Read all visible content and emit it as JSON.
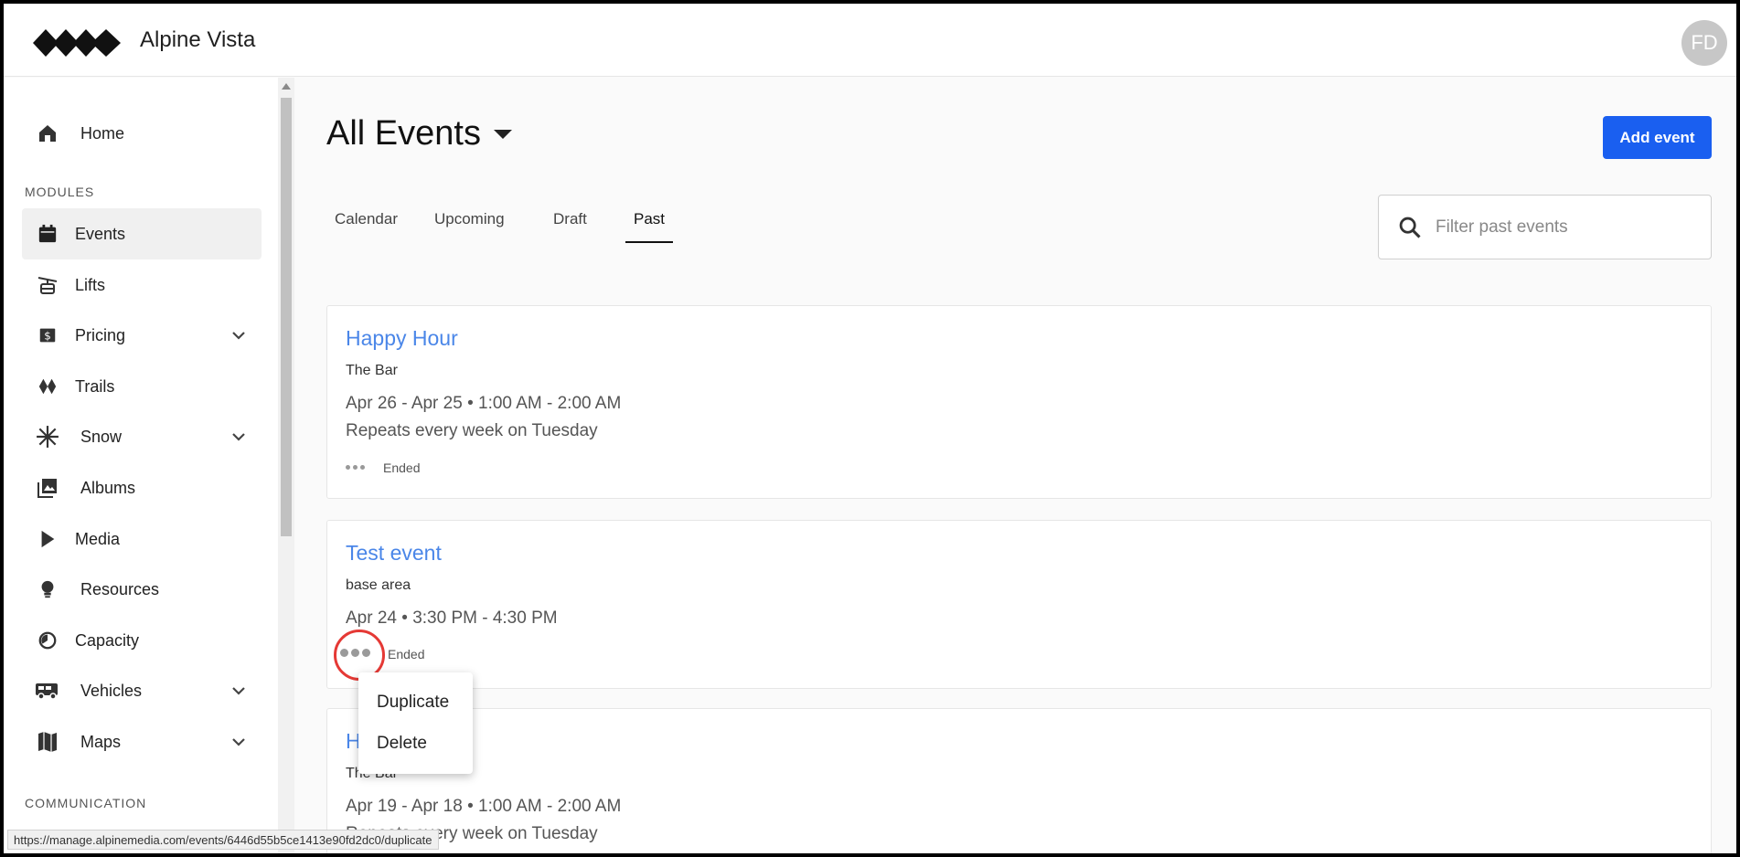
{
  "app": {
    "name": "Alpine Vista",
    "avatar_initials": "FD"
  },
  "sidebar": {
    "home": "Home",
    "modules_heading": "MODULES",
    "items": [
      {
        "label": "Events",
        "icon": "calendar-icon"
      },
      {
        "label": "Lifts",
        "icon": "lift-icon"
      },
      {
        "label": "Pricing",
        "icon": "price-tag-icon"
      },
      {
        "label": "Trails",
        "icon": "trails-icon"
      },
      {
        "label": "Snow",
        "icon": "snowflake-icon"
      },
      {
        "label": "Albums",
        "icon": "albums-icon"
      },
      {
        "label": "Media",
        "icon": "play-icon"
      },
      {
        "label": "Resources",
        "icon": "lightbulb-icon"
      },
      {
        "label": "Capacity",
        "icon": "gauge-icon"
      },
      {
        "label": "Vehicles",
        "icon": "bus-icon"
      },
      {
        "label": "Maps",
        "icon": "map-icon"
      }
    ],
    "communication_heading": "COMMUNICATION"
  },
  "main": {
    "title": "All Events",
    "add_button": "Add event",
    "tabs": [
      "Calendar",
      "Upcoming",
      "Draft",
      "Past"
    ],
    "active_tab": "Past",
    "search_placeholder": "Filter past events",
    "events": [
      {
        "title": "Happy Hour",
        "location": "The Bar",
        "when": "Apr 26 - Apr 25 • 1:00 AM - 2:00 AM",
        "repeat": "Repeats every week on Tuesday",
        "status": "Ended"
      },
      {
        "title": "Test event",
        "location": "base area",
        "when": "Apr 24 • 3:30 PM - 4:30 PM",
        "status": "Ended"
      },
      {
        "title": "H",
        "location": "The Bar",
        "when": "Apr 19 - Apr 18 • 1:00 AM - 2:00 AM",
        "repeat": "Repeats every week on Tuesday"
      }
    ]
  },
  "context_menu": {
    "items": [
      "Duplicate",
      "Delete"
    ]
  },
  "status_url": "https://manage.alpinemedia.com/events/6446d55b5ce1413e90fd2dc0/duplicate",
  "colors": {
    "primary": "#1a5ff0",
    "link": "#4a86e8",
    "highlight": "#e53935"
  }
}
